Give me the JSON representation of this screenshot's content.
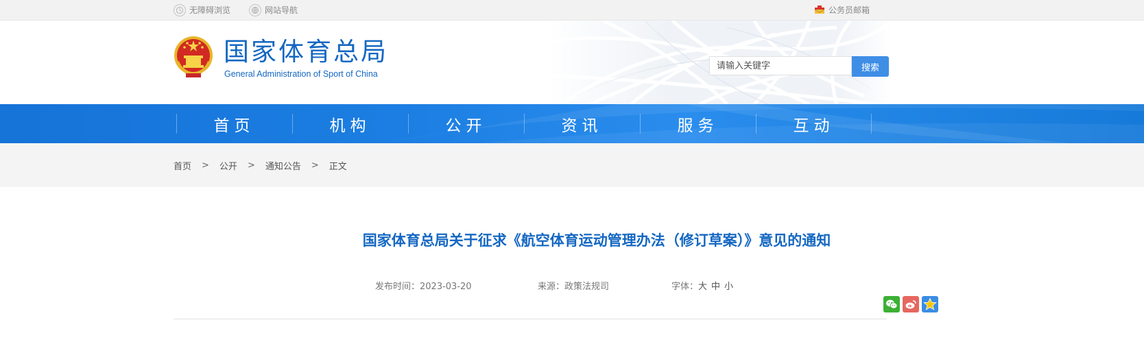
{
  "topbar": {
    "accessibility_label": "无障碍浏览",
    "site_nav_label": "网站导航",
    "staff_mail_label": "公务员邮箱"
  },
  "header": {
    "logo_cn": "国家体育总局",
    "logo_en": "General Administration of Sport of China",
    "search_placeholder": "请输入关键字",
    "search_button": "搜索"
  },
  "nav": {
    "items": [
      {
        "label": "首页"
      },
      {
        "label": "机构"
      },
      {
        "label": "公开"
      },
      {
        "label": "资讯"
      },
      {
        "label": "服务"
      },
      {
        "label": "互动"
      }
    ]
  },
  "breadcrumb": {
    "items": [
      "首页",
      "公开",
      "通知公告",
      "正文"
    ],
    "separator": ">"
  },
  "article": {
    "title": "国家体育总局关于征求《航空体育运动管理办法（修订草案）》意见的通知",
    "publish_label": "发布时间：",
    "publish_date": "2023-03-20",
    "source_label": "来源：",
    "source_value": "政策法规司",
    "font_label": "字体：",
    "font_large": "大",
    "font_medium": "中",
    "font_small": "小"
  },
  "share": {
    "icons": [
      "wechat-icon",
      "weibo-icon",
      "qzone-icon"
    ]
  },
  "colors": {
    "brand_blue": "#1467c2",
    "nav_blue": "#1c7ee2",
    "search_button": "#3f8ee6",
    "wechat_green": "#3cb034",
    "weibo_red": "#e5675f"
  }
}
